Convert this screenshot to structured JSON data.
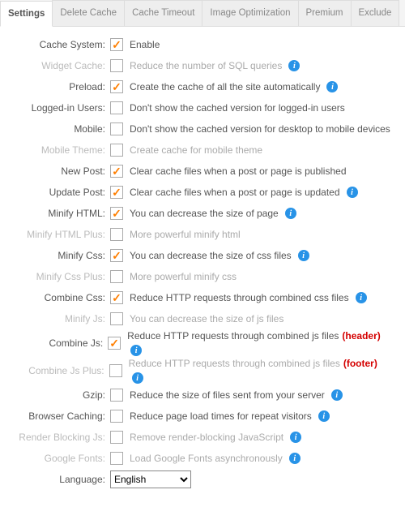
{
  "tabs": [
    {
      "label": "Settings",
      "active": true
    },
    {
      "label": "Delete Cache",
      "active": false
    },
    {
      "label": "Cache Timeout",
      "active": false
    },
    {
      "label": "Image Optimization",
      "active": false
    },
    {
      "label": "Premium",
      "active": false
    },
    {
      "label": "Exclude",
      "active": false
    }
  ],
  "rows": [
    {
      "label": "Cache System:",
      "checked": true,
      "disabled": false,
      "desc": "Enable",
      "info": false
    },
    {
      "label": "Widget Cache:",
      "checked": false,
      "disabled": true,
      "desc": "Reduce the number of SQL queries",
      "info": true
    },
    {
      "label": "Preload:",
      "checked": true,
      "disabled": false,
      "desc": "Create the cache of all the site automatically",
      "info": true
    },
    {
      "label": "Logged-in Users:",
      "checked": false,
      "disabled": false,
      "desc": "Don't show the cached version for logged-in users",
      "info": false
    },
    {
      "label": "Mobile:",
      "checked": false,
      "disabled": false,
      "desc": "Don't show the cached version for desktop to mobile devices",
      "info": false
    },
    {
      "label": "Mobile Theme:",
      "checked": false,
      "disabled": true,
      "desc": "Create cache for mobile theme",
      "info": false
    },
    {
      "label": "New Post:",
      "checked": true,
      "disabled": false,
      "desc": "Clear cache files when a post or page is published",
      "info": false
    },
    {
      "label": "Update Post:",
      "checked": true,
      "disabled": false,
      "desc": "Clear cache files when a post or page is updated",
      "info": true
    },
    {
      "label": "Minify HTML:",
      "checked": true,
      "disabled": false,
      "desc": "You can decrease the size of page",
      "info": true
    },
    {
      "label": "Minify HTML Plus:",
      "checked": false,
      "disabled": true,
      "desc": "More powerful minify html",
      "info": false
    },
    {
      "label": "Minify Css:",
      "checked": true,
      "disabled": false,
      "desc": "You can decrease the size of css files",
      "info": true
    },
    {
      "label": "Minify Css Plus:",
      "checked": false,
      "disabled": true,
      "desc": "More powerful minify css",
      "info": false
    },
    {
      "label": "Combine Css:",
      "checked": true,
      "disabled": false,
      "desc": "Reduce HTTP requests through combined css files",
      "info": true
    },
    {
      "label": "Minify Js:",
      "checked": false,
      "disabled": true,
      "desc": "You can decrease the size of js files",
      "info": false
    },
    {
      "label": "Combine Js:",
      "checked": true,
      "disabled": false,
      "desc": "Reduce HTTP requests through combined js files",
      "extra": "(header)",
      "info": true
    },
    {
      "label": "Combine Js Plus:",
      "checked": false,
      "disabled": true,
      "desc": "Reduce HTTP requests through combined js files",
      "extra": "(footer)",
      "info": true
    },
    {
      "label": "Gzip:",
      "checked": false,
      "disabled": false,
      "desc": "Reduce the size of files sent from your server",
      "info": true
    },
    {
      "label": "Browser Caching:",
      "checked": false,
      "disabled": false,
      "desc": "Reduce page load times for repeat visitors",
      "info": true
    },
    {
      "label": "Render Blocking Js:",
      "checked": false,
      "disabled": true,
      "desc": "Remove render-blocking JavaScript",
      "info": true
    },
    {
      "label": "Google Fonts:",
      "checked": false,
      "disabled": true,
      "desc": "Load Google Fonts asynchronously",
      "info": true
    }
  ],
  "language": {
    "label": "Language:",
    "value": "English"
  },
  "info_glyph": "i"
}
